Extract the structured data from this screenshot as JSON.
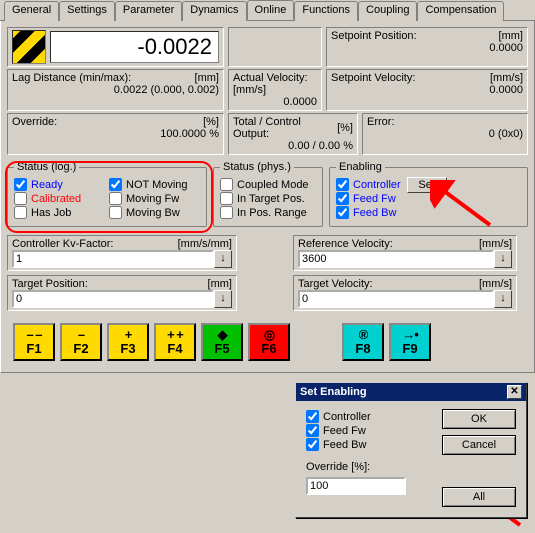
{
  "tabs": [
    "General",
    "Settings",
    "Parameter",
    "Dynamics",
    "Online",
    "Functions",
    "Coupling",
    "Compensation"
  ],
  "active_tab": "Online",
  "top": {
    "main_value": "-0.0022",
    "setpos_label": "Setpoint Position:",
    "setpos_unit": "[mm]",
    "setpos_val": "0.0000",
    "lag_label": "Lag Distance (min/max):",
    "lag_unit": "[mm]",
    "lag_val": "0.0022 (0.000, 0.002)",
    "actvel_label": "Actual Velocity:",
    "actvel_unit": "[mm/s]",
    "actvel_val": "0.0000",
    "setvel_label": "Setpoint Velocity:",
    "setvel_unit": "[mm/s]",
    "setvel_val": "0.0000",
    "override_label": "Override:",
    "override_unit": "[%]",
    "override_val": "100.0000 %",
    "tco_label": "Total / Control Output:",
    "tco_unit": "[%]",
    "tco_val": "0.00 / 0.00 %",
    "error_label": "Error:",
    "error_val": "0 (0x0)"
  },
  "status_log": {
    "legend": "Status (log.)",
    "ready": "Ready",
    "calibrated": "Calibrated",
    "hasjob": "Has Job",
    "notmoving": "NOT Moving",
    "movfw": "Moving Fw",
    "movbw": "Moving Bw"
  },
  "status_phys": {
    "legend": "Status (phys.)",
    "coupled": "Coupled Mode",
    "intarget": "In Target Pos.",
    "inposrange": "In Pos. Range"
  },
  "enabling": {
    "legend": "Enabling",
    "controller": "Controller",
    "feedfw": "Feed Fw",
    "feedbw": "Feed Bw",
    "set": "Set"
  },
  "kv": {
    "label": "Controller Kv-Factor:",
    "unit": "[mm/s/mm]",
    "val": "1"
  },
  "refvel": {
    "label": "Reference Velocity:",
    "unit": "[mm/s]",
    "val": "3600"
  },
  "tpos": {
    "label": "Target Position:",
    "unit": "[mm]",
    "val": "0"
  },
  "tvel": {
    "label": "Target Velocity:",
    "unit": "[mm/s]",
    "val": "0"
  },
  "fkeys": {
    "f1": {
      "sym": "– –",
      "lbl": "F1"
    },
    "f2": {
      "sym": "–",
      "lbl": "F2"
    },
    "f3": {
      "sym": "+",
      "lbl": "F3"
    },
    "f4": {
      "sym": "+ +",
      "lbl": "F4"
    },
    "f5": {
      "sym": "◆",
      "lbl": "F5"
    },
    "f6": {
      "sym": "◎",
      "lbl": "F6"
    },
    "f8": {
      "sym": "®",
      "lbl": "F8"
    },
    "f9": {
      "sym": "→•",
      "lbl": "F9"
    }
  },
  "dialog": {
    "title": "Set Enabling",
    "controller": "Controller",
    "feedfw": "Feed Fw",
    "feedbw": "Feed Bw",
    "override_label": "Override [%]:",
    "override_val": "100",
    "ok": "OK",
    "cancel": "Cancel",
    "all": "All"
  }
}
